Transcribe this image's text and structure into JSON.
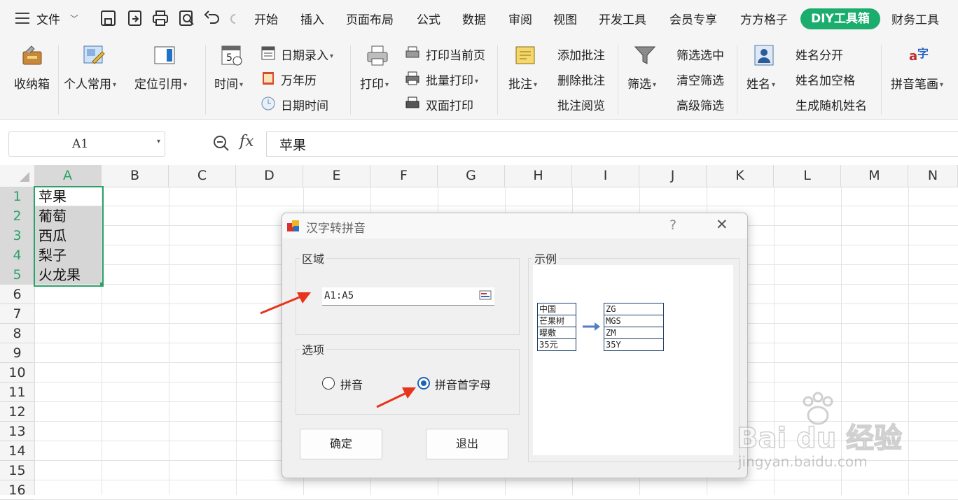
{
  "menu": {
    "hamburger_icon": "hamburger-icon",
    "file_label": "文件",
    "tabs": [
      "开始",
      "插入",
      "页面布局",
      "公式",
      "数据",
      "审阅",
      "视图",
      "开发工具",
      "会员专享",
      "方方格子"
    ],
    "active_tab": "DIY工具箱",
    "last_tab": "财务工具"
  },
  "ribbon": {
    "storage": "收纳箱",
    "personal": "个人常用",
    "locate": "定位引用",
    "time": "时间",
    "date_entry": "日期录入",
    "calendar": "万年历",
    "datetime": "日期时间",
    "print": "打印",
    "print_current": "打印当前页",
    "batch_print": "批量打印",
    "duplex_print": "双面打印",
    "comment": "批注",
    "add_comment": "添加批注",
    "delete_comment": "删除批注",
    "view_comment": "批注阅览",
    "filter": "筛选",
    "filter_selected": "筛选选中",
    "clear_filter": "清空筛选",
    "advanced_filter": "高级筛选",
    "name": "姓名",
    "split_name": "姓名分开",
    "name_space": "姓名加空格",
    "random_name": "生成随机姓名",
    "pinyin_stroke": "拼音笔画"
  },
  "formula_bar": {
    "name_box": "A1",
    "fx": "fx",
    "content": "苹果"
  },
  "sheet": {
    "columns": [
      "A",
      "B",
      "C",
      "D",
      "E",
      "F",
      "G",
      "H",
      "I",
      "J",
      "K",
      "L",
      "M",
      "N"
    ],
    "rows": [
      "1",
      "2",
      "3",
      "4",
      "5",
      "6",
      "7",
      "8",
      "9",
      "10",
      "11",
      "12",
      "13",
      "14",
      "15",
      "16"
    ],
    "cells_a": [
      "苹果",
      "葡萄",
      "西瓜",
      "梨子",
      "火龙果"
    ]
  },
  "dialog": {
    "title": "汉字转拼音",
    "help": "?",
    "close": "✕",
    "region_label": "区域",
    "region_value": "A1:A5",
    "options_label": "选项",
    "opt_pinyin": "拼音",
    "opt_initials": "拼音首字母",
    "example_label": "示例",
    "example_left": [
      "中国",
      "芒果树",
      "曝敷",
      "35元"
    ],
    "example_right": [
      "ZG",
      "MGS",
      "ZM",
      "35Y"
    ],
    "ok": "确定",
    "exit": "退出"
  },
  "watermark": {
    "brand": "Bai du 经验",
    "url": "jingyan.baidu.com"
  },
  "colors": {
    "accent": "#1aad6e",
    "selection": "#2aa26a",
    "radio": "#1e66b5",
    "arrow": "#e8341c"
  }
}
